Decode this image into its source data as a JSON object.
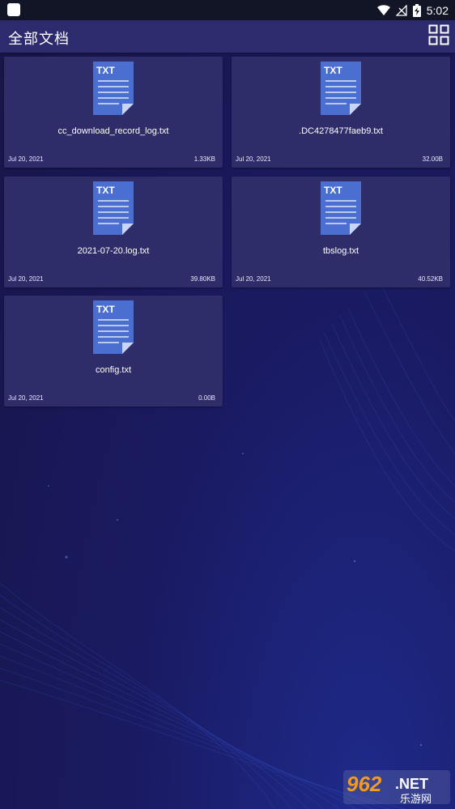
{
  "status_bar": {
    "time": "5:02",
    "icons": [
      "app-notification-icon",
      "wifi-icon",
      "no-signal-icon",
      "battery-charging-icon"
    ]
  },
  "app_bar": {
    "title": "全部文档",
    "view_toggle_icon": "grid-view-icon"
  },
  "files": [
    {
      "type_label": "TXT",
      "name": "cc_download_record_log.txt",
      "date": "Jul 20, 2021",
      "size": "1.33KB"
    },
    {
      "type_label": "TXT",
      "name": ".DC4278477faeb9.txt",
      "date": "Jul 20, 2021",
      "size": "32.00B"
    },
    {
      "type_label": "TXT",
      "name": "2021-07-20.log.txt",
      "date": "Jul 20, 2021",
      "size": "39.80KB"
    },
    {
      "type_label": "TXT",
      "name": "tbslog.txt",
      "date": "Jul 20, 2021",
      "size": "40.52KB"
    },
    {
      "type_label": "TXT",
      "name": "config.txt",
      "date": "Jul 20, 2021",
      "size": "0.00B"
    }
  ],
  "watermark": {
    "brand": "962",
    "suffix": ".NET",
    "subtitle": "乐游网"
  },
  "colors": {
    "status_bar": "#121526",
    "app_bar": "#2b2b6e",
    "card": "#2e2c69",
    "doc_icon": "#4a6fd0",
    "background": "#1a1a62"
  }
}
